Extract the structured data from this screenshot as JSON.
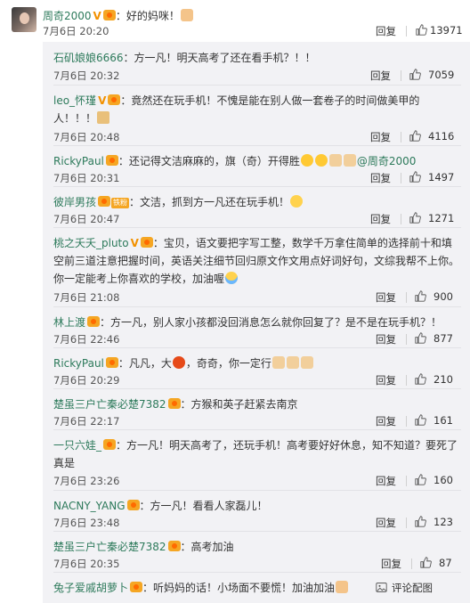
{
  "top_comment": {
    "username": "周奇2000",
    "text": "：好的妈咪！",
    "date": "7月6日",
    "time": "20:20",
    "reply_label": "回复",
    "like_count": "13971"
  },
  "replies": [
    {
      "username": "石矶娘娘6666",
      "text": "：方一凡！明天高考了还在看手机？！！",
      "date": "7月6日",
      "time": "20:32",
      "reply_label": "回复",
      "like_count": "7059"
    },
    {
      "username": "leo_怀瑾",
      "text": "：竟然还在玩手机！不愧是能在别人做一套卷子的时间做美甲的人！！！",
      "date": "7月6日",
      "time": "20:48",
      "reply_label": "回复",
      "like_count": "4116"
    },
    {
      "username": "RickyPaul",
      "text": "：还记得文洁麻麻的，旗（奇）开得胜",
      "mention": "@周奇2000",
      "date": "7月6日",
      "time": "20:31",
      "reply_label": "回复",
      "like_count": "1497"
    },
    {
      "username": "彼岸男孩",
      "badge_text": "铁粉",
      "text": "：文洁，抓到方一凡还在玩手机！",
      "date": "7月6日",
      "time": "20:47",
      "reply_label": "回复",
      "like_count": "1271"
    },
    {
      "username": "桃之夭夭_pluto",
      "text": "：宝贝，语文要把字写工整，数学千万拿住简单的选择前十和填空前三道注意把握时间，英语关注细节回归原文作文用点好词好句，文综我帮不上你。你一定能考上你喜欢的学校，加油喔",
      "date": "7月6日",
      "time": "21:08",
      "reply_label": "回复",
      "like_count": "900"
    },
    {
      "username": "林上渡",
      "text": "：方一凡，别人家小孩都没回消息怎么就你回复了？是不是在玩手机？！",
      "date": "7月6日",
      "time": "22:46",
      "reply_label": "回复",
      "like_count": "877"
    },
    {
      "username": "RickyPaul",
      "text_a": "：凡凡，大",
      "text_b": "，奇奇，你一定行",
      "date": "7月6日",
      "time": "20:29",
      "reply_label": "回复",
      "like_count": "210"
    },
    {
      "username": "楚虽三户亡秦必楚7382",
      "text": "：方猴和英子赶紧去南京",
      "date": "7月6日",
      "time": "22:17",
      "reply_label": "回复",
      "like_count": "161"
    },
    {
      "username": "一只六娃_",
      "text": "：方一凡！明天高考了，还玩手机！高考要好好休息，知不知道？要死了真是",
      "date": "7月6日",
      "time": "23:26",
      "reply_label": "回复",
      "like_count": "160"
    },
    {
      "username": "NACNY_YANG",
      "text": "：方一凡！看看人家磊儿！",
      "date": "7月6日",
      "time": "23:48",
      "reply_label": "回复",
      "like_count": "123"
    },
    {
      "username": "楚虽三户亡秦必楚7382",
      "text": "：高考加油",
      "date": "7月6日",
      "time": "20:35",
      "reply_label": "回复",
      "like_count": "87"
    },
    {
      "username": "兔子爱戚胡萝卜",
      "text": "：听妈妈的话！小场面不要慌！加油加油",
      "footer_link": "评论配图"
    }
  ]
}
